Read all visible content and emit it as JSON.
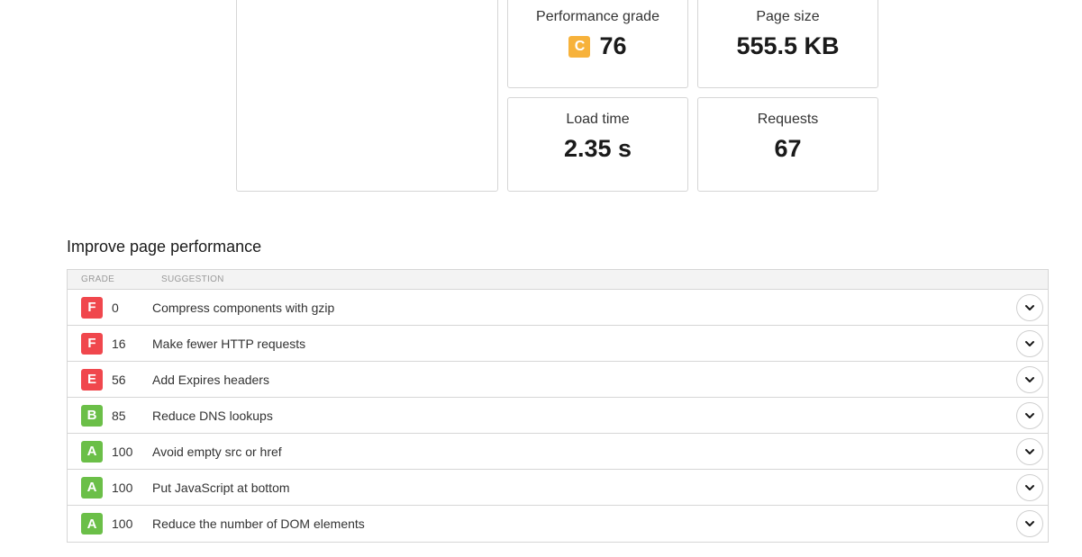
{
  "metrics": {
    "performance_grade": {
      "label": "Performance grade",
      "letter": "C",
      "value": "76"
    },
    "page_size": {
      "label": "Page size",
      "value": "555.5 KB"
    },
    "load_time": {
      "label": "Load time",
      "value": "2.35 s"
    },
    "requests": {
      "label": "Requests",
      "value": "67"
    }
  },
  "improve": {
    "title": "Improve page performance",
    "headers": {
      "grade": "GRADE",
      "suggestion": "SUGGESTION"
    },
    "rows": [
      {
        "grade": "F",
        "score": "0",
        "suggestion": "Compress components with gzip"
      },
      {
        "grade": "F",
        "score": "16",
        "suggestion": "Make fewer HTTP requests"
      },
      {
        "grade": "E",
        "score": "56",
        "suggestion": "Add Expires headers"
      },
      {
        "grade": "B",
        "score": "85",
        "suggestion": "Reduce DNS lookups"
      },
      {
        "grade": "A",
        "score": "100",
        "suggestion": "Avoid empty src or href"
      },
      {
        "grade": "A",
        "score": "100",
        "suggestion": "Put JavaScript at bottom"
      },
      {
        "grade": "A",
        "score": "100",
        "suggestion": "Reduce the number of DOM elements"
      }
    ]
  },
  "colors": {
    "A": "#6bbf48",
    "B": "#6bbf48",
    "C": "#f7b23b",
    "E": "#f0474d",
    "F": "#f0474d"
  },
  "icons": {
    "expand": "chevron-down-icon"
  }
}
